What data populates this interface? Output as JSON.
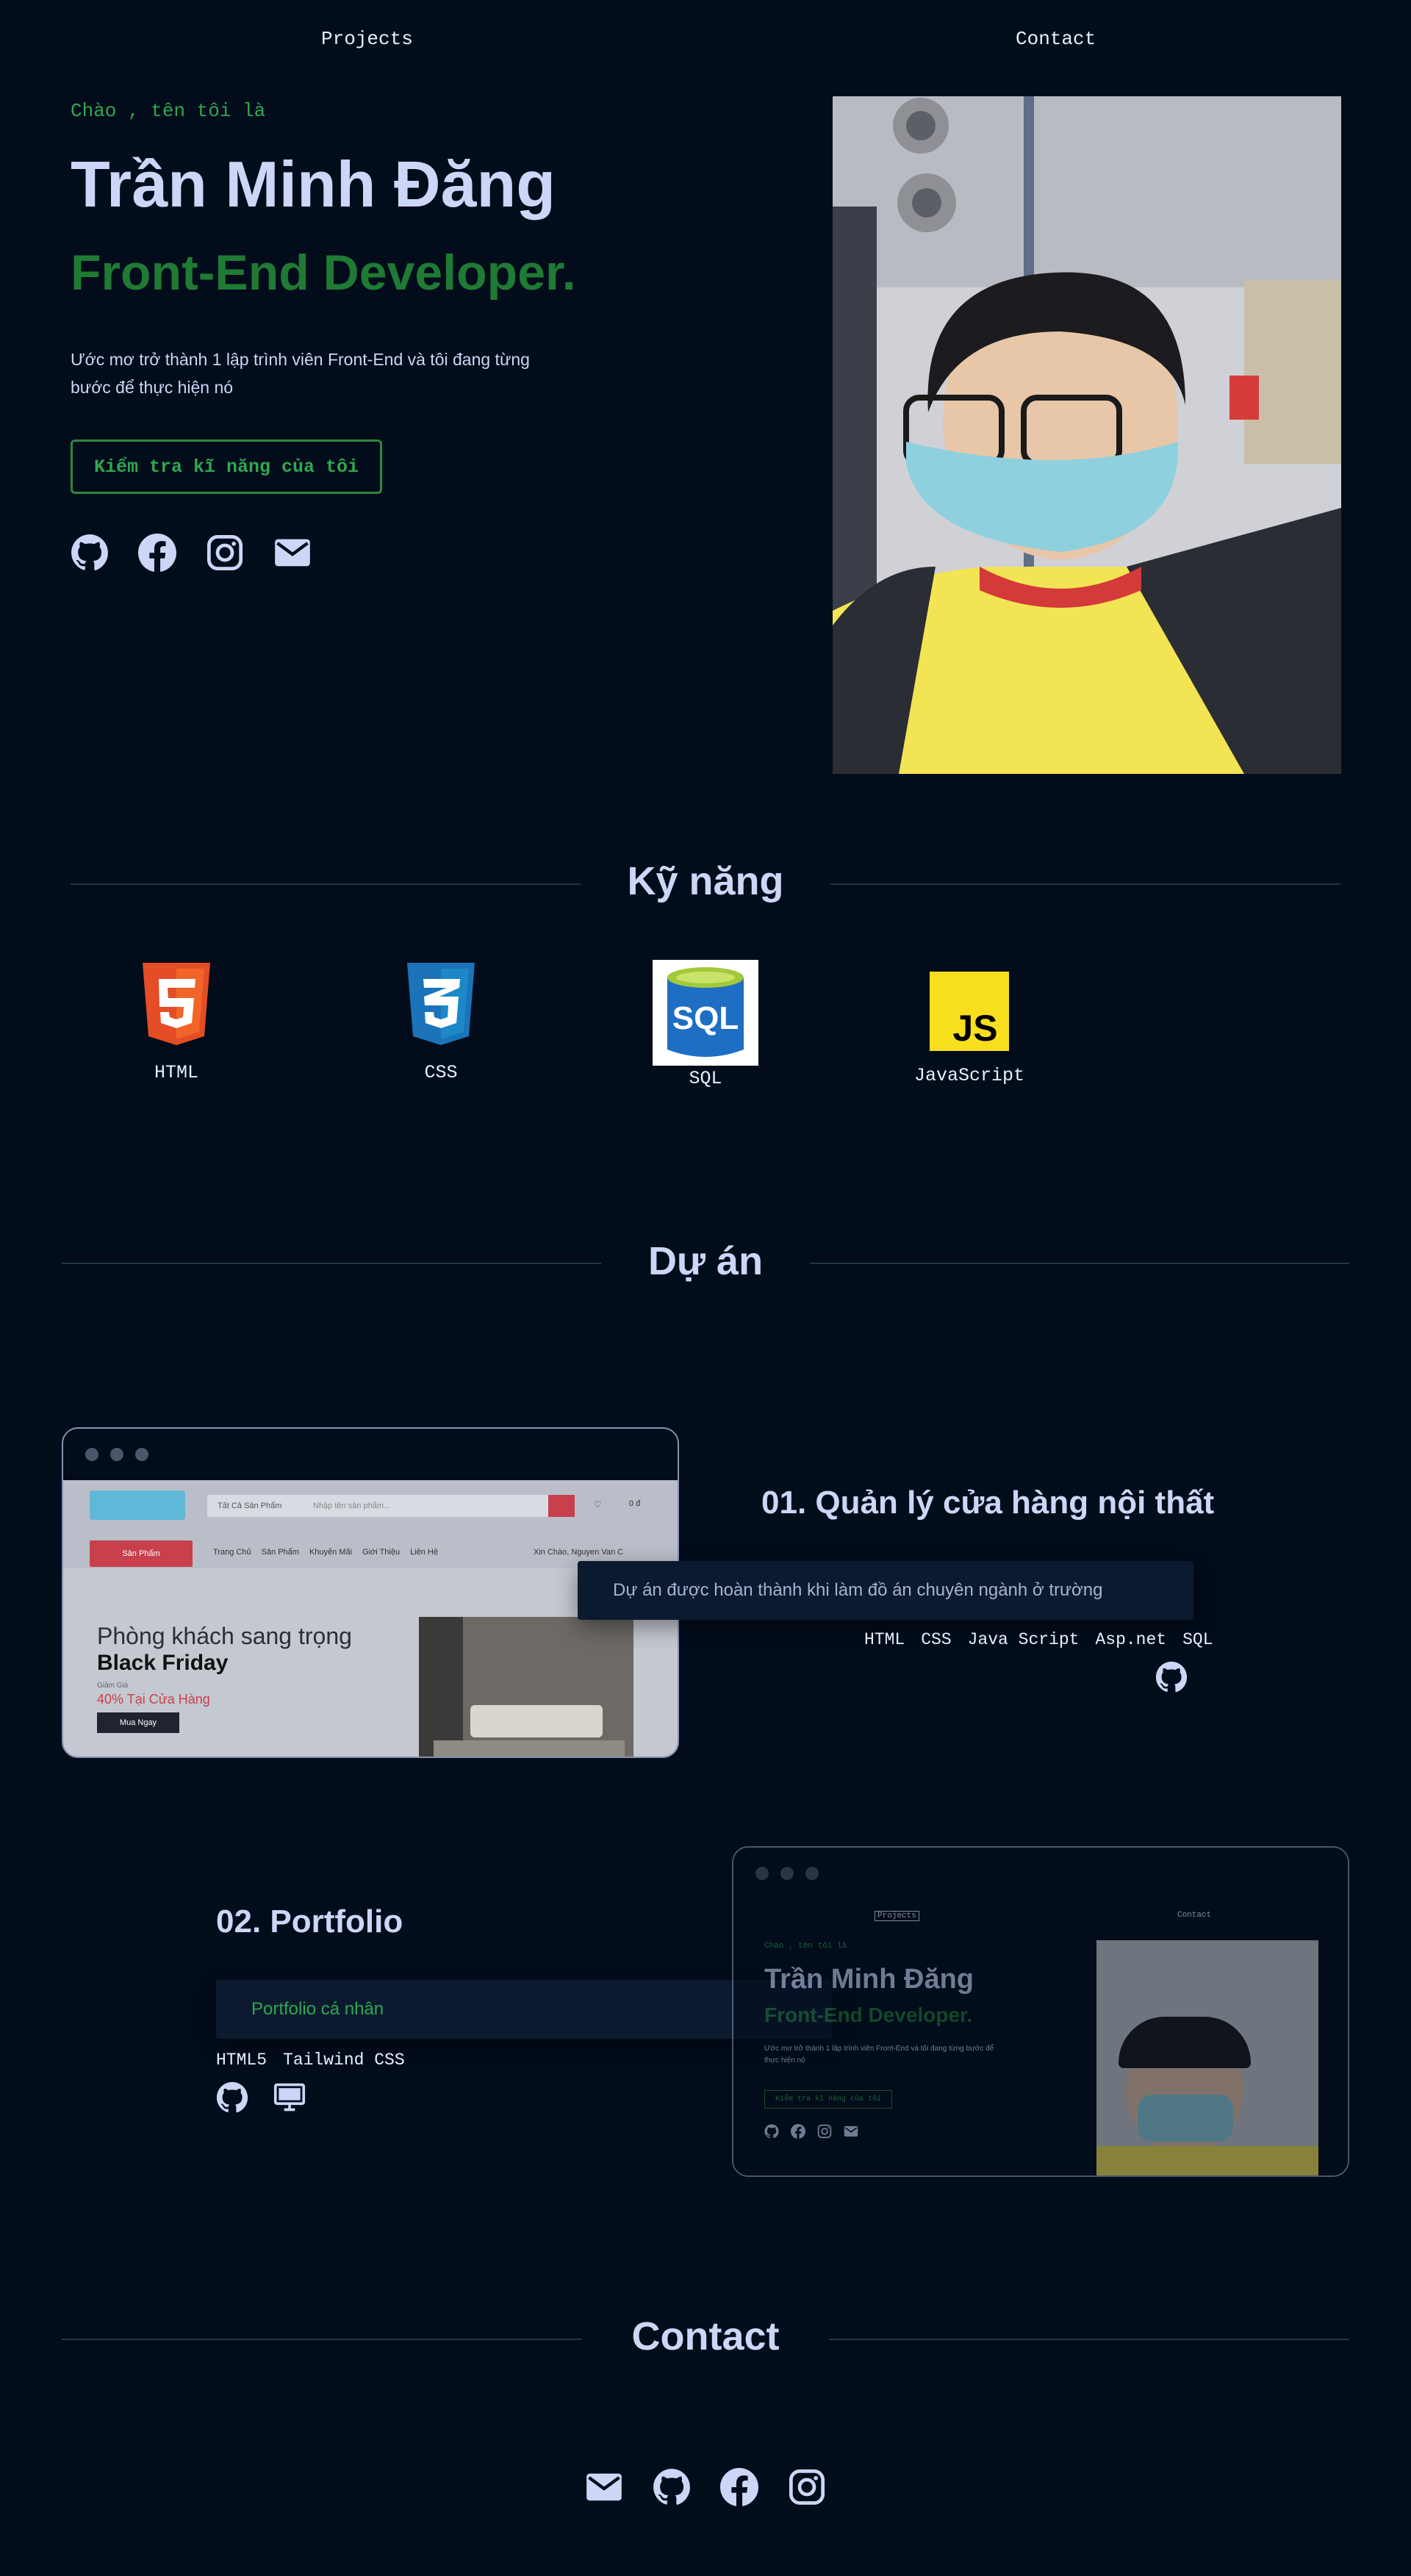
{
  "nav": {
    "projects": "Projects",
    "contact": "Contact"
  },
  "hero": {
    "greeting": "Chào , tên tôi là",
    "name": "Trần Minh Đăng",
    "role": "Front-End Developer.",
    "description": "Ước mơ trở thành 1 lập trình viên Front-End và tôi đang từng bước để thực hiện nó",
    "cta": "Kiểm tra kĩ năng của tôi",
    "socials": [
      "github-icon",
      "facebook-icon",
      "instagram-icon",
      "mail-icon"
    ]
  },
  "skills": {
    "title": "Kỹ năng",
    "items": [
      {
        "label": "HTML",
        "icon": "html5-icon",
        "color": "#e44d26"
      },
      {
        "label": "CSS",
        "icon": "css3-icon",
        "color": "#1b73ba"
      },
      {
        "label": "SQL",
        "icon": "sql-database-icon",
        "color": "#1e6fc4"
      },
      {
        "label": "JavaScript",
        "icon": "javascript-icon",
        "color": "#f7df1e"
      }
    ]
  },
  "projects": {
    "title": "Dự án",
    "items": [
      {
        "title": "01. Quản lý cửa hàng nội thất",
        "description": "Dự án được hoàn thành khi làm đồ án chuyên ngành ở trường",
        "tech": [
          "HTML",
          "CSS",
          "Java Script",
          "Asp.net",
          "SQL"
        ],
        "preview": {
          "search_category": "Tất Cả Sản Phẩm",
          "search_placeholder": "Nhập tên sản phẩm...",
          "cart_total": "0 đ",
          "menu_button": "Sản Phẩm",
          "nav": [
            "Trang Chủ",
            "Sản Phẩm",
            "Khuyến Mãi",
            "Giới Thiệu",
            "Liên Hệ"
          ],
          "greeting": "Xin Chào, Nguyen Van C",
          "banner_line1": "Phòng khách sang trọng",
          "banner_line2": "Black Friday",
          "banner_small": "Giảm Giá",
          "banner_discount": "40% Tại Cửa Hàng",
          "banner_button": "Mua Ngay"
        }
      },
      {
        "title": "02. Portfolio",
        "description": "Portfolio cá nhân",
        "tech": [
          "HTML5",
          "Tailwind CSS"
        ]
      }
    ]
  },
  "contact": {
    "title": "Contact",
    "icons": [
      "mail-icon",
      "github-icon",
      "facebook-icon",
      "instagram-icon"
    ]
  },
  "colors": {
    "background": "#020c1b",
    "accent": "#2fa84f",
    "role": "#1f7a34",
    "text": "#ccd6f6"
  }
}
